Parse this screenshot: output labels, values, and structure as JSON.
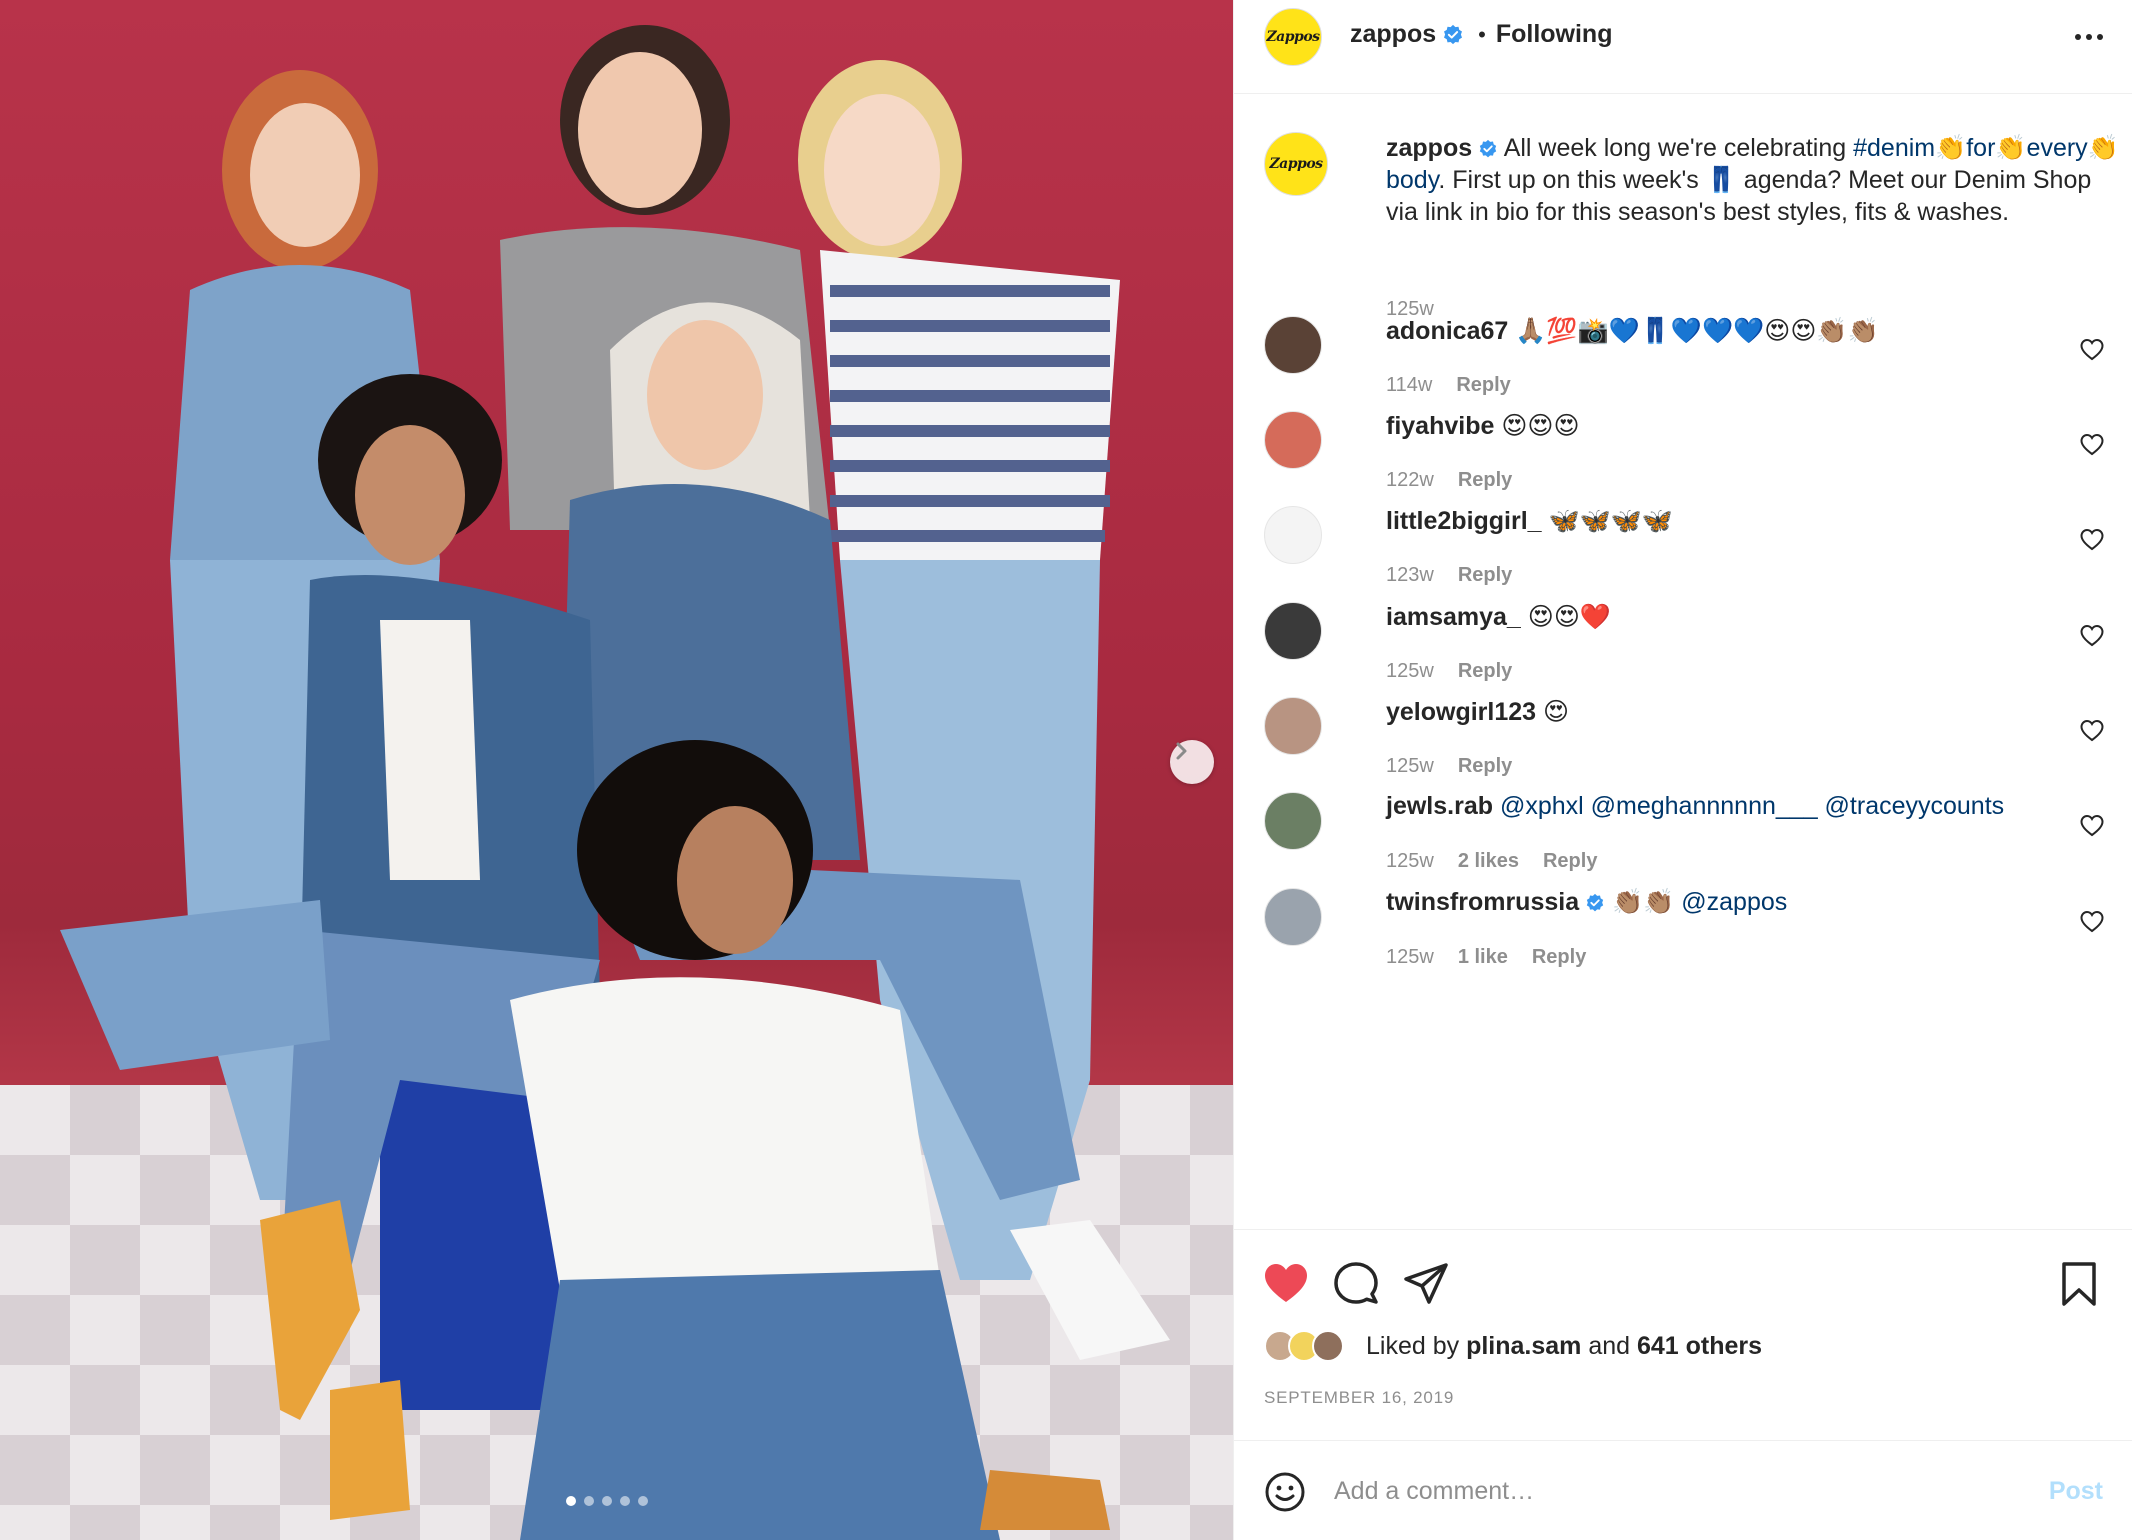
{
  "post": {
    "username": "zappos",
    "avatar_text": "Zappos",
    "follow_status": "Following",
    "separator": "•"
  },
  "carousel": {
    "total_slides": 5,
    "active_slide": 1
  },
  "caption": {
    "username": "zappos",
    "text_1": "All week long we're celebrating ",
    "hashtag": "#denim👏for👏every👏body",
    "text_2": ". First up on this week's 👖 agenda? Meet our Denim Shop via link in bio for this season's best styles, fits & washes.",
    "time": "125w"
  },
  "comments": [
    {
      "username": "adonica67",
      "text": "🙏🏽💯📸💙👖💙💙💙😍😍👏🏽👏🏽",
      "time": "114w",
      "likes": "",
      "reply": "Reply",
      "verified": false
    },
    {
      "username": "fiyahvibe",
      "text": "😍😍😍",
      "time": "122w",
      "likes": "",
      "reply": "Reply",
      "verified": false
    },
    {
      "username": "little2biggirl_",
      "text": "🦋🦋🦋🦋",
      "time": "123w",
      "likes": "",
      "reply": "Reply",
      "verified": false
    },
    {
      "username": "iamsamya_",
      "text": "😍😍❤️",
      "time": "125w",
      "likes": "",
      "reply": "Reply",
      "verified": false
    },
    {
      "username": "yelowgirl123",
      "text": "😍",
      "time": "125w",
      "likes": "",
      "reply": "Reply",
      "verified": false
    },
    {
      "username": "jewls.rab",
      "text": "@xphxl @meghannnnnn___ @traceyycounts",
      "time": "125w",
      "likes": "2 likes",
      "reply": "Reply",
      "verified": false
    },
    {
      "username": "twinsfromrussia",
      "text": "👏🏽👏🏽 @zappos",
      "time": "125w",
      "likes": "1 like",
      "reply": "Reply",
      "verified": true
    }
  ],
  "actions": {
    "like_icon": "heart-filled-icon",
    "comment_icon": "comment-icon",
    "share_icon": "paper-plane-icon",
    "save_icon": "bookmark-icon",
    "like_color": "#ed4956"
  },
  "likes": {
    "prefix": "Liked by ",
    "user": "plina.sam",
    "middle": " and ",
    "others": "641 others"
  },
  "date": "SEPTEMBER 16, 2019",
  "add_comment": {
    "placeholder": "Add a comment…",
    "post_label": "Post"
  },
  "colors": {
    "accent": "#0095f6",
    "link": "#00376b",
    "verified": "#3897f0",
    "zappos_yellow": "#ffe318",
    "photo_red": "#b23647"
  }
}
